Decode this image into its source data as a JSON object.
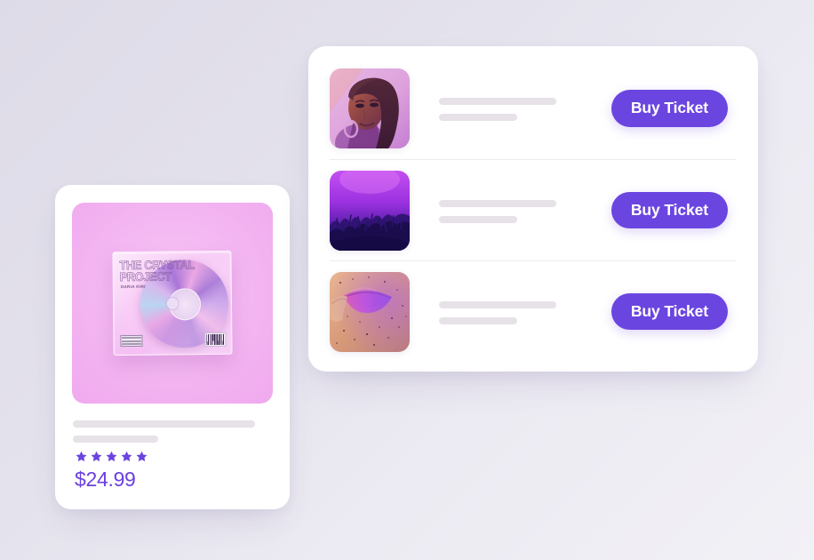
{
  "theme": {
    "background_gradient_start": "#dedbe8",
    "background_gradient_end": "#f2f1f6",
    "accent_purple": "#6b45e0",
    "price_purple": "#6b3fe0",
    "star_purple": "#6b45e0",
    "card_white": "#ffffff",
    "skeleton_bar": "#e7e1e8",
    "divider": "#ececee"
  },
  "product_card": {
    "album": {
      "title": "THE CRYSTAL\nPROJECT",
      "artist": "DARIA KIRI",
      "parental_advisory_label": "PARENTAL ADVISORY EXPLICIT CONTENT",
      "barcode_label": "barcode"
    },
    "title_placeholder_1": "",
    "title_placeholder_2": "",
    "rating": {
      "value": 5,
      "max": 5,
      "stars": [
        "star-1",
        "star-2",
        "star-3",
        "star-4",
        "star-5"
      ]
    },
    "price": "$24.99"
  },
  "event_card": {
    "rows": [
      {
        "thumbnail_name": "portrait-neon-woman",
        "line_1_placeholder": "",
        "line_2_placeholder": "",
        "buy_label": "Buy Ticket"
      },
      {
        "thumbnail_name": "concert-crowd-purple",
        "line_1_placeholder": "",
        "line_2_placeholder": "",
        "buy_label": "Buy Ticket"
      },
      {
        "thumbnail_name": "glitter-lips-closeup",
        "line_1_placeholder": "",
        "line_2_placeholder": "",
        "buy_label": "Buy Ticket"
      }
    ]
  }
}
